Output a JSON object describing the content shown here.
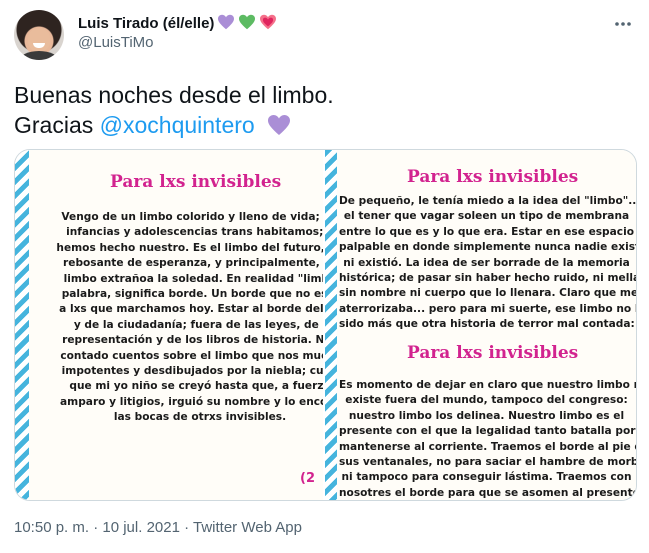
{
  "tweet": {
    "display_name": "Luis Tirado (él/elle)",
    "name_emojis": [
      "💜",
      "💚",
      "💗"
    ],
    "handle": "@LuisTiMo",
    "more_icon": "more-horizontal-icon",
    "text_line1": "Buenas noches desde el limbo.",
    "text_line2_prefix": "Gracias",
    "mention": "@xochquintero",
    "trailing_emoji": "purple-heart",
    "timestamp": "10:50 p. m. · 10 jul. 2021 · ",
    "source": "Twitter Web App"
  },
  "media": {
    "left_panel": {
      "title": "Para lxs invisibles",
      "lines": [
        "Vengo de un limbo colorido y lleno de vida; un",
        "infancias y adolescencias trans habitamos; y",
        "hemos hecho nuestro. Es el limbo del futuro, un",
        "rebosante de esperanza, y principalmente, es",
        "limbo extrañoa la soledad. En realidad \"limbo",
        "palabra, significa borde. Un borde que no es a",
        "a lxs que marchamos hoy. Estar al borde del Es",
        "y de la ciudadanía; fuera de las leyes, de l",
        "representación y de los libros de historia. Nos",
        "contado cuentos sobre el limbo que nos muest",
        "impotentes y desdibujados por la niebla; cuen",
        "que mi yo niño se creyó hasta que, a fuerza",
        "amparo y litigios, irguió su nombre y lo encont",
        "las bocas de otrxs invisibles."
      ],
      "badge": "(2"
    },
    "right_panel": {
      "title_top": "Para lxs invisibles",
      "lines_top": [
        "De pequeño, le tenía miedo a la idea del \"limbo\"...",
        "el tener que vagar soleen un tipo de membrana",
        "entre lo que es y lo que era. Estar en ese espacio",
        "palpable en donde simplemente nunca nadie existe",
        "ni existió. La idea de ser borrade de la memoria",
        "histórica; de pasar sin haber hecho ruido, ni mella;",
        "sin nombre ni cuerpo que lo llenara. Claro que me",
        "aterrorizaba... pero para mi suerte, ese limbo no ha",
        "sido más que otra historia de terror mal contada:"
      ],
      "title_bottom": "Para lxs invisibles",
      "lines_bottom": [
        "Es momento de dejar en claro que nuestro limbo no",
        "existe fuera del mundo, tampoco del congreso:",
        "nuestro limbo los delinea. Nuestro limbo es el",
        "presente con el que la legalidad tanto batalla por",
        "mantenerse al corriente. Traemos el borde al pie de",
        "sus ventanales, no para saciar el hambre de morbo,",
        "ni tampoco para conseguir lástima. Traemos con",
        "nosotres el borde para que se asomen al presente y"
      ]
    }
  },
  "colors": {
    "accent_blue": "#1d9bf0",
    "title_magenta": "#d2238f",
    "stripe_blue": "#45b4dd",
    "secondary_text": "#536471"
  }
}
